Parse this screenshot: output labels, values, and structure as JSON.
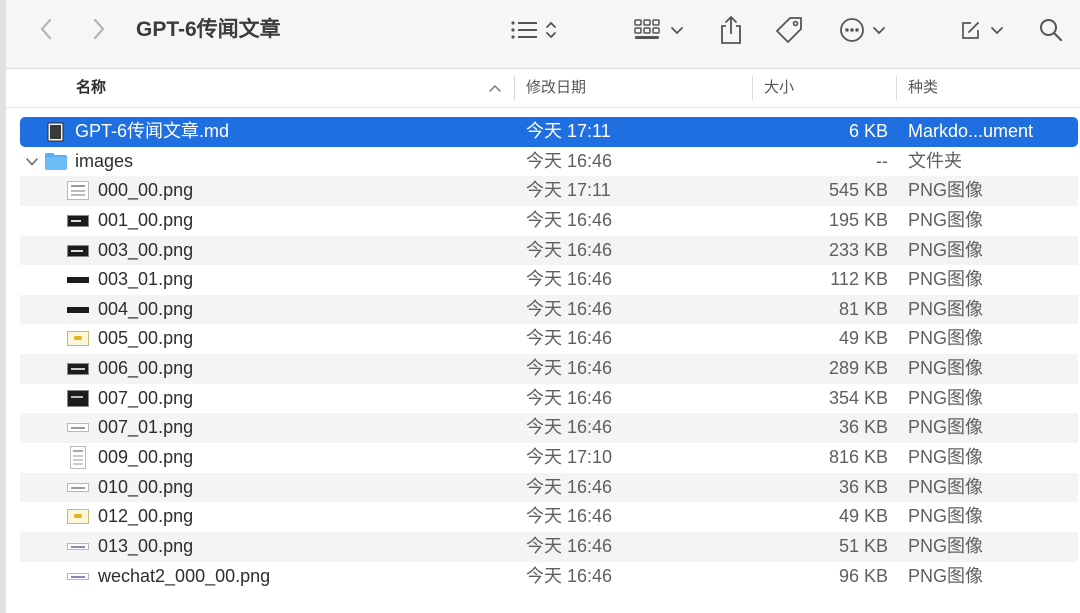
{
  "window": {
    "title": "GPT-6传闻文章"
  },
  "toolbar": {
    "back_icon": "chevron-left-icon",
    "forward_icon": "chevron-right-icon",
    "view_list_icon": "list-icon",
    "grid_icon": "grid-icon",
    "share_icon": "share-icon",
    "tag_icon": "tag-icon",
    "more_icon": "ellipsis-circle-icon",
    "edit_icon": "compose-icon",
    "search_icon": "search-icon"
  },
  "columns": {
    "name": "名称",
    "date": "修改日期",
    "size": "大小",
    "kind": "种类"
  },
  "colors": {
    "selection": "#1f6fe0",
    "folder": "#5aaef0"
  },
  "files": [
    {
      "name": "GPT-6传闻文章.md",
      "date": "今天 17:11",
      "size": "6 KB",
      "kind": "Markdo...ument",
      "type": "md",
      "selected": true
    },
    {
      "name": "images",
      "date": "今天 16:46",
      "size": "--",
      "kind": "文件夹",
      "type": "folder"
    },
    {
      "name": "000_00.png",
      "date": "今天 17:11",
      "size": "545 KB",
      "kind": "PNG图像",
      "type": "png-doc"
    },
    {
      "name": "001_00.png",
      "date": "今天 16:46",
      "size": "195 KB",
      "kind": "PNG图像",
      "type": "png-dark"
    },
    {
      "name": "003_00.png",
      "date": "今天 16:46",
      "size": "233 KB",
      "kind": "PNG图像",
      "type": "png-dark"
    },
    {
      "name": "003_01.png",
      "date": "今天 16:46",
      "size": "112 KB",
      "kind": "PNG图像",
      "type": "png-bar"
    },
    {
      "name": "004_00.png",
      "date": "今天 16:46",
      "size": "81 KB",
      "kind": "PNG图像",
      "type": "png-bar"
    },
    {
      "name": "005_00.png",
      "date": "今天 16:46",
      "size": "49 KB",
      "kind": "PNG图像",
      "type": "png-yellow"
    },
    {
      "name": "006_00.png",
      "date": "今天 16:46",
      "size": "289 KB",
      "kind": "PNG图像",
      "type": "png-dark"
    },
    {
      "name": "007_00.png",
      "date": "今天 16:46",
      "size": "354 KB",
      "kind": "PNG图像",
      "type": "png-dark"
    },
    {
      "name": "007_01.png",
      "date": "今天 16:46",
      "size": "36 KB",
      "kind": "PNG图像",
      "type": "png-light"
    },
    {
      "name": "009_00.png",
      "date": "今天 17:10",
      "size": "816 KB",
      "kind": "PNG图像",
      "type": "png-doc"
    },
    {
      "name": "010_00.png",
      "date": "今天 16:46",
      "size": "36 KB",
      "kind": "PNG图像",
      "type": "png-light"
    },
    {
      "name": "012_00.png",
      "date": "今天 16:46",
      "size": "49 KB",
      "kind": "PNG图像",
      "type": "png-yellow"
    },
    {
      "name": "013_00.png",
      "date": "今天 16:46",
      "size": "51 KB",
      "kind": "PNG图像",
      "type": "png-light"
    },
    {
      "name": "wechat2_000_00.png",
      "date": "今天 16:46",
      "size": "96 KB",
      "kind": "PNG图像",
      "type": "png-light"
    }
  ]
}
